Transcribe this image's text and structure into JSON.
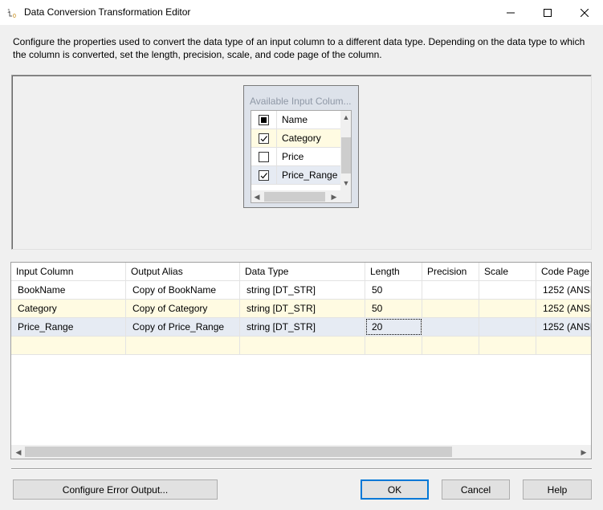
{
  "window": {
    "title": "Data Conversion Transformation Editor"
  },
  "description": {
    "line1": "Configure the properties used to convert the data type of an input column to a different data type. Depending on the data type to which",
    "line2": "the column is converted, set the length, precision, scale, and code page of the column."
  },
  "available_columns": {
    "title": "Available Input Colum...",
    "header": "Name",
    "items": [
      {
        "label": "Category",
        "checked": true
      },
      {
        "label": "Price",
        "checked": false
      },
      {
        "label": "Price_Range",
        "checked": true
      }
    ]
  },
  "grid": {
    "headers": [
      "Input Column",
      "Output Alias",
      "Data Type",
      "Length",
      "Precision",
      "Scale",
      "Code Page"
    ],
    "rows": [
      [
        "BookName",
        "Copy of BookName",
        "string [DT_STR]",
        "50",
        "",
        "",
        "1252  (ANSI"
      ],
      [
        "Category",
        "Copy of Category",
        "string [DT_STR]",
        "50",
        "",
        "",
        "1252  (ANSI"
      ],
      [
        "Price_Range",
        "Copy of Price_Range",
        "string [DT_STR]",
        "20",
        "",
        "",
        "1252  (ANSI"
      ]
    ]
  },
  "buttons": {
    "config_error": "Configure Error Output...",
    "ok": "OK",
    "cancel": "Cancel",
    "help": "Help"
  }
}
